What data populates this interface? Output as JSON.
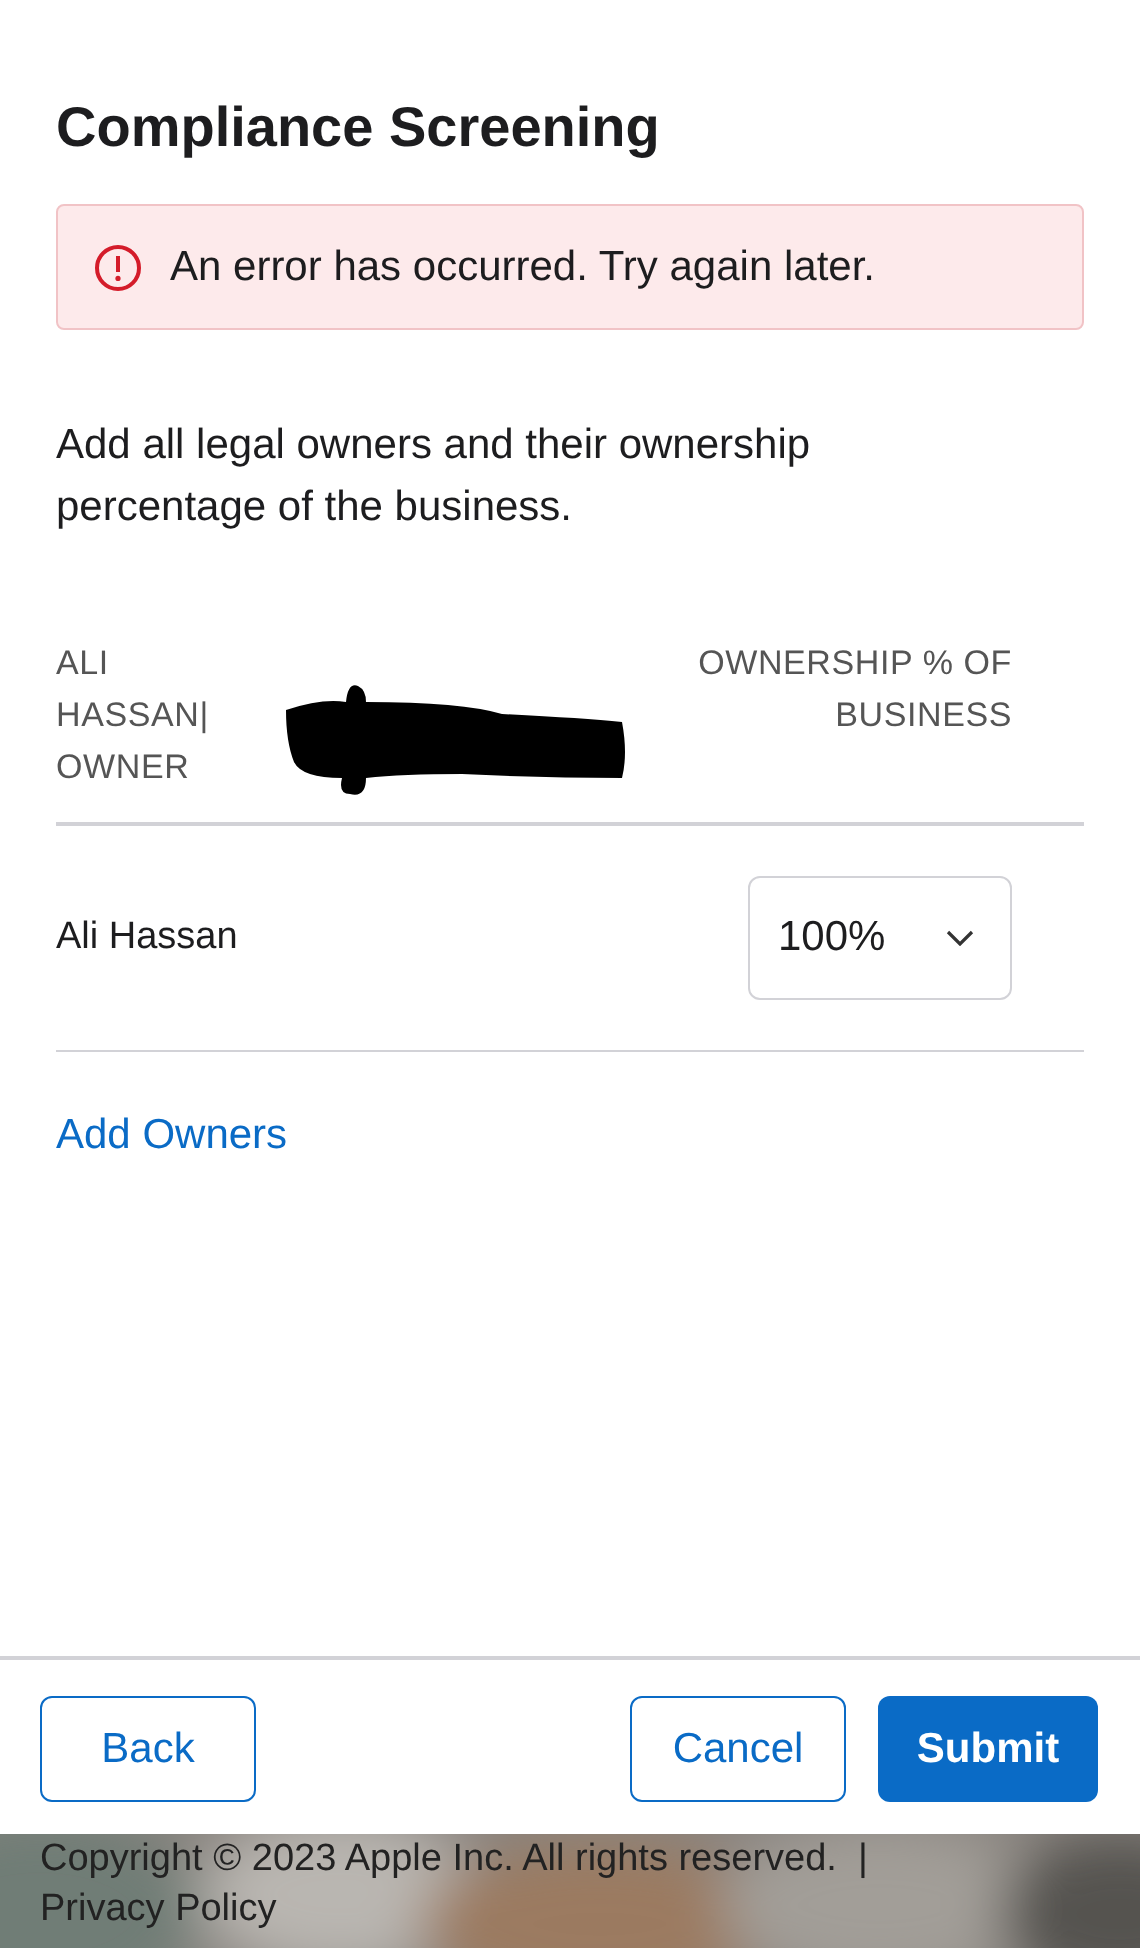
{
  "title": "Compliance Screening",
  "alert": {
    "message": "An error has occurred. Try again later."
  },
  "intro": "Add all legal owners and their ownership percentage of the business.",
  "table": {
    "columns": [
      "ALI HASSAN| OWNER",
      "OWNERSHIP % OF BUSINESS"
    ],
    "rows": [
      {
        "name": "Ali Hassan",
        "ownership": "100%"
      }
    ]
  },
  "add_link": "Add Owners",
  "buttons": [
    {
      "label": "Back",
      "kind": "secondary"
    },
    {
      "label": "Cancel",
      "kind": "secondary"
    },
    {
      "label": "Submit",
      "kind": "primary"
    }
  ],
  "footer": {
    "copyright": "Copyright © 2023 Apple Inc. All rights reserved.",
    "separator": "|",
    "link": "Privacy Policy"
  }
}
